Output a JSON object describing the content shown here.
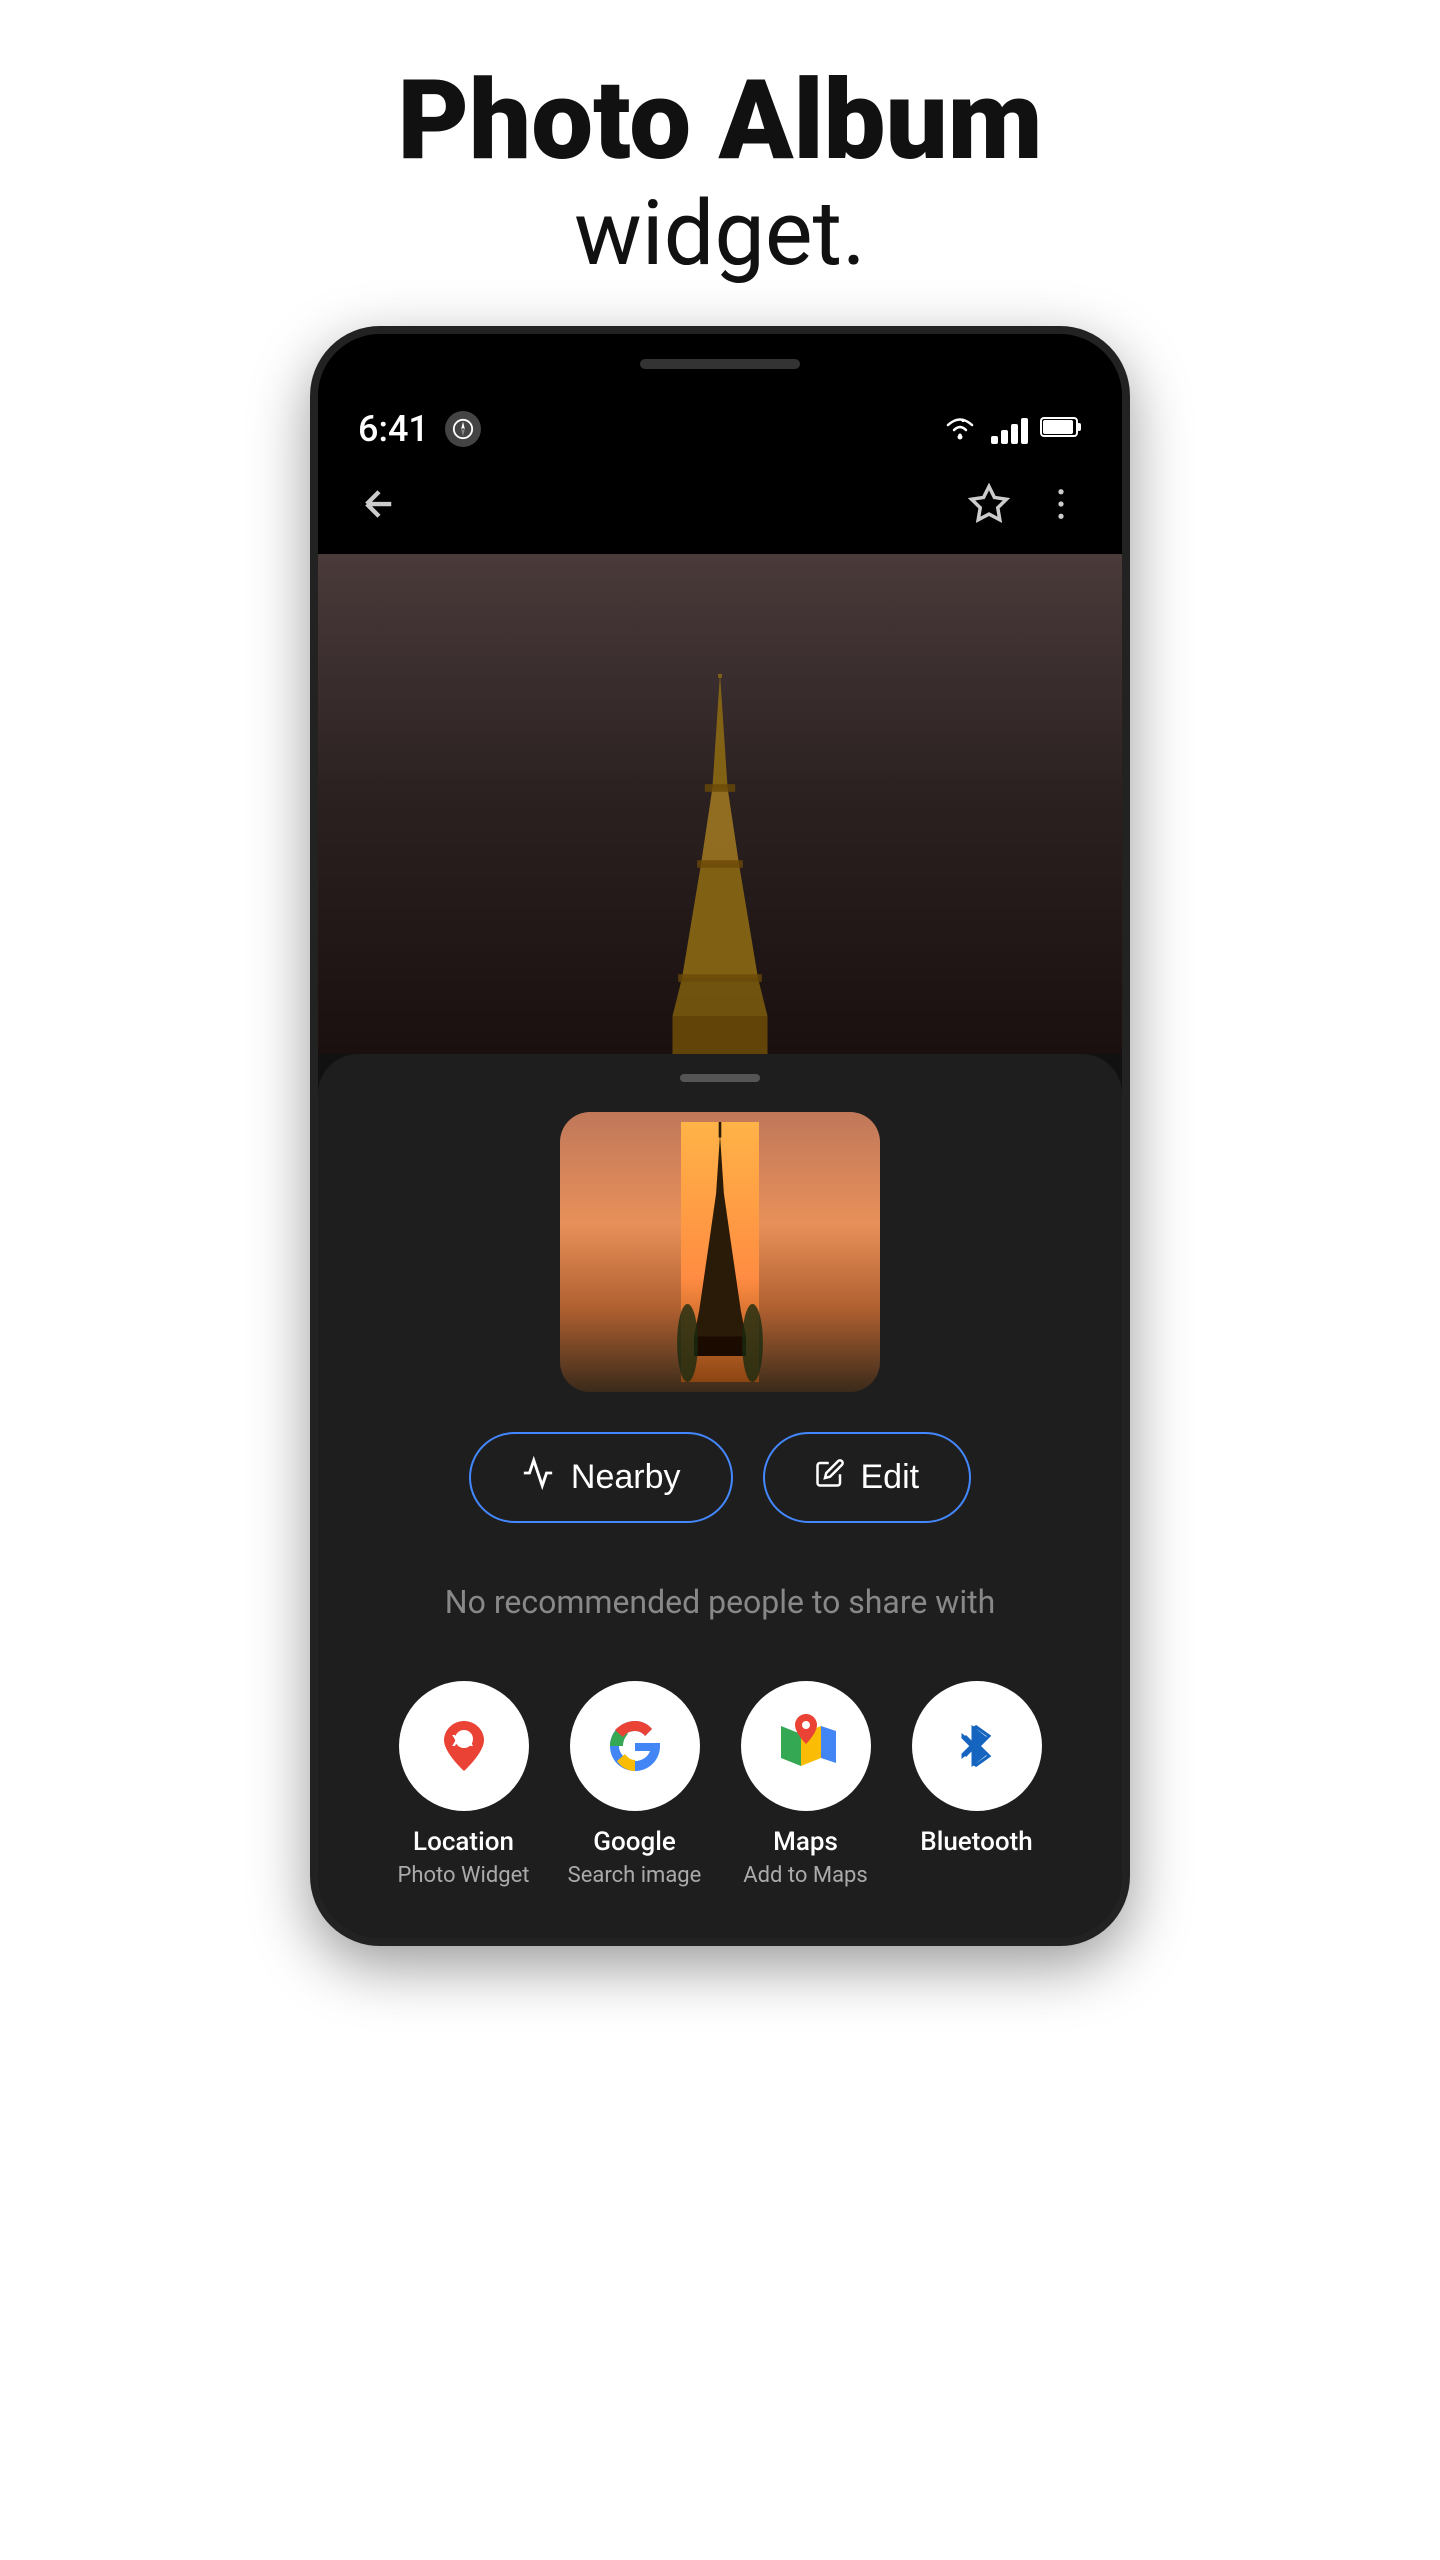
{
  "header": {
    "title_main": "Photo Album",
    "title_sub": "widget."
  },
  "status_bar": {
    "time": "6:41",
    "wifi": "▼",
    "signal": "▲",
    "battery": "🔋"
  },
  "action_bar": {
    "back_icon": "←",
    "star_icon": "☆",
    "more_icon": "⋮"
  },
  "bottom_sheet": {
    "nearby_label": "Nearby",
    "edit_label": "Edit",
    "no_people_text": "No recommended people to share with"
  },
  "share_apps": [
    {
      "name": "location-app",
      "label": "Location",
      "sublabel": "Photo Widget"
    },
    {
      "name": "google-app",
      "label": "Google",
      "sublabel": "Search image"
    },
    {
      "name": "maps-app",
      "label": "Maps",
      "sublabel": "Add to Maps"
    },
    {
      "name": "bluetooth-app",
      "label": "Bluetooth",
      "sublabel": ""
    }
  ]
}
